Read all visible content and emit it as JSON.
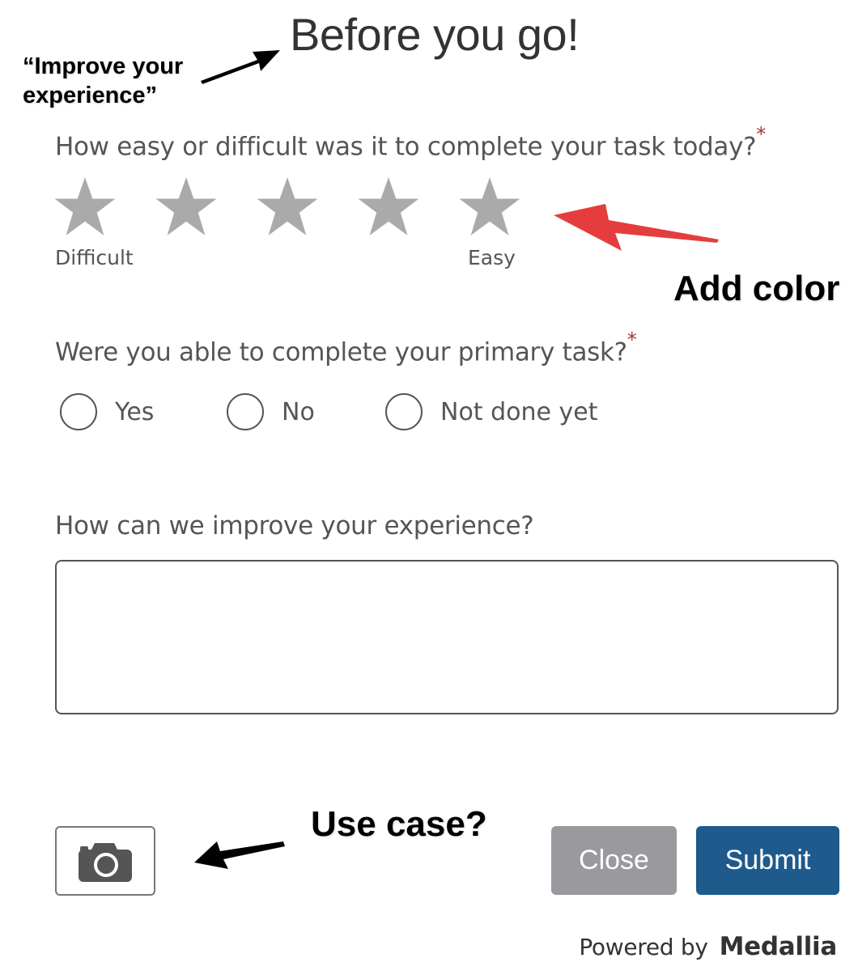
{
  "survey": {
    "title": "Before you go!",
    "questions": [
      {
        "text": "How easy or difficult was it to complete your task today?",
        "required_marker": "*",
        "type": "star-rating",
        "scale_max": 5,
        "selected_rating": 0,
        "low_label": "Difficult",
        "high_label": "Easy"
      },
      {
        "text": "Were you able to complete your primary task?",
        "required_marker": "*",
        "type": "radio",
        "options": [
          "Yes",
          "No",
          "Not done yet"
        ],
        "selected": null
      },
      {
        "text": "How can we improve your experience?",
        "type": "textarea",
        "value": "",
        "placeholder": ""
      }
    ],
    "buttons": {
      "screenshot_icon": "camera-icon",
      "close": "Close",
      "submit": "Submit"
    },
    "footer": {
      "powered_by": "Powered by",
      "brand": "Medallia"
    }
  },
  "annotations": {
    "title_note": "“Improve your experience”",
    "stars_note": "Add color",
    "camera_note": "Use case?"
  },
  "colors": {
    "star_empty": "#aaaaaa",
    "required": "#a83232",
    "submit": "#1e5a8c",
    "close": "#9a9a9e",
    "annotation_arrow_red": "#e53d3d",
    "annotation_arrow_black": "#000000"
  }
}
